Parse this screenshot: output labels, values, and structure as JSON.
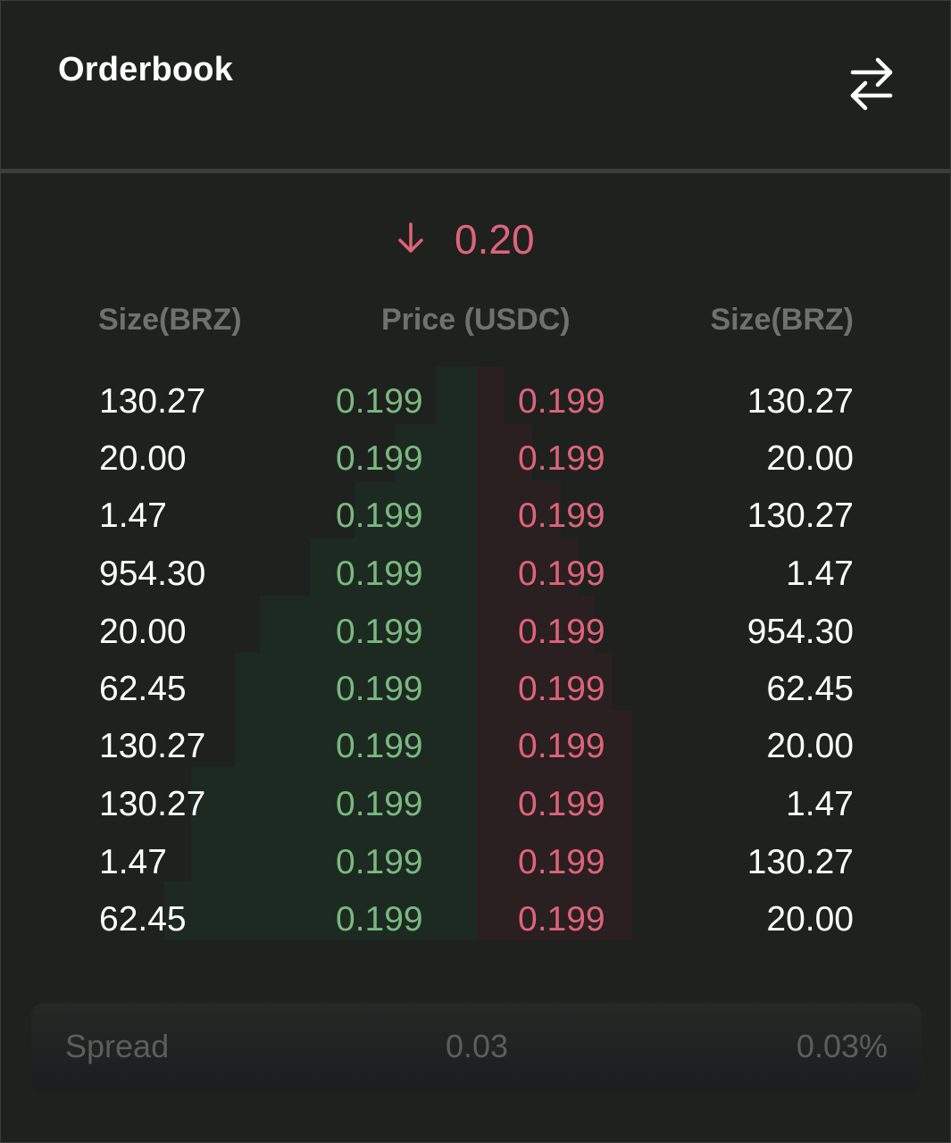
{
  "header": {
    "title": "Orderbook",
    "swap_icon": "swap-arrows-icon"
  },
  "last_price": {
    "direction_icon": "arrow-down-icon",
    "value": "0.20",
    "color": "#de6477"
  },
  "columns": {
    "bid_size": "Size(BRZ)",
    "price": "Price (USDC)",
    "ask_size": "Size(BRZ)"
  },
  "colors": {
    "bid": "#7ab97e",
    "ask": "#de6477",
    "bid_depth": "#1c2a22",
    "ask_depth": "#2a1f21"
  },
  "rows": [
    {
      "bid_size": "130.27",
      "bid_price": "0.199",
      "ask_price": "0.199",
      "ask_size": "130.27"
    },
    {
      "bid_size": "20.00",
      "bid_price": "0.199",
      "ask_price": "0.199",
      "ask_size": "20.00"
    },
    {
      "bid_size": "1.47",
      "bid_price": "0.199",
      "ask_price": "0.199",
      "ask_size": "130.27"
    },
    {
      "bid_size": "954.30",
      "bid_price": "0.199",
      "ask_price": "0.199",
      "ask_size": "1.47"
    },
    {
      "bid_size": "20.00",
      "bid_price": "0.199",
      "ask_price": "0.199",
      "ask_size": "954.30"
    },
    {
      "bid_size": "62.45",
      "bid_price": "0.199",
      "ask_price": "0.199",
      "ask_size": "62.45"
    },
    {
      "bid_size": "130.27",
      "bid_price": "0.199",
      "ask_price": "0.199",
      "ask_size": "20.00"
    },
    {
      "bid_size": "130.27",
      "bid_price": "0.199",
      "ask_price": "0.199",
      "ask_size": "1.47"
    },
    {
      "bid_size": "1.47",
      "bid_price": "0.199",
      "ask_price": "0.199",
      "ask_size": "130.27"
    },
    {
      "bid_size": "62.45",
      "bid_price": "0.199",
      "ask_price": "0.199",
      "ask_size": "20.00"
    }
  ],
  "spread": {
    "label": "Spread",
    "value": "0.03",
    "percent": "0.03%"
  }
}
